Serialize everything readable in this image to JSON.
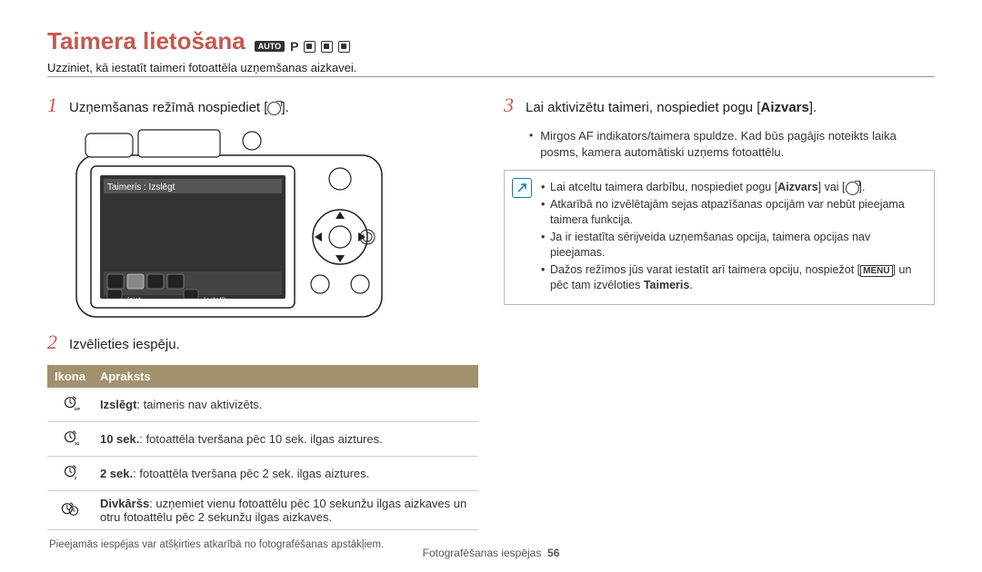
{
  "title": "Taimera lietošana",
  "subtitle": "Uzziniet, kā iestatīt taimeri fotoattēla uzņemšanas aizkavei.",
  "modes": {
    "auto": "AUTO",
    "p": "P"
  },
  "steps": {
    "s1": "Uzņemšanas režīmā nospiediet [",
    "s1_end": "].",
    "s2": "Izvēlieties iespēju.",
    "s3_a": "Lai aktivizētu taimeri, nospiediet pogu [",
    "s3_bold": "Aizvars",
    "s3_b": "]."
  },
  "camera_lcd": {
    "title": "Taimeris : Izslēgt",
    "exit": "Iziet",
    "set": "Iestatīt"
  },
  "table": {
    "h1": "Ikona",
    "h2": "Apraksts",
    "rows": [
      {
        "icon_sub": "OFF",
        "label_bold": "Izslēgt",
        "label_rest": ": taimeris nav aktivizēts."
      },
      {
        "icon_sub": "10",
        "label_bold": "10 sek.",
        "label_rest": ": fotoattēla tveršana pēc 10 sek. ilgas aiztures."
      },
      {
        "icon_sub": "2",
        "label_bold": "2 sek.",
        "label_rest": ": fotoattēla tveršana pēc 2 sek. ilgas aiztures."
      },
      {
        "icon_sub": "",
        "label_bold": "Divkāršs",
        "label_rest": ": uzņemiet vienu fotoattēlu pēc 10 sekunžu ilgas aizkaves un otru fotoattēlu pēc 2 sekunžu ilgas aizkaves."
      }
    ]
  },
  "note": "Pieejamās iespējas var atšķirties atkarībā no fotografēšanas apstākļiem.",
  "right_bullets": [
    "Mirgos AF indikators/taimera spuldze. Kad būs pagājis noteikts laika posms, kamera automātiski uzņems fotoattēlu."
  ],
  "infobox": [
    {
      "pre": "Lai atceltu taimera darbību, nospiediet pogu [",
      "bold": "Aizvars",
      "post": "] vai [",
      "icon": true,
      "end": "]."
    },
    {
      "text": "Atkarībā no izvēlētajām sejas atpazīšanas opcijām var nebūt pieejama taimera funkcija."
    },
    {
      "text": "Ja ir iestatīta sērijveida uzņemšanas opcija, taimera opcijas nav pieejamas."
    },
    {
      "pre": "Dažos režīmos jūs varat iestatīt arī taimera opciju, nospiežot [",
      "menu": "MENU",
      "post": "] un pēc tam izvēloties ",
      "bold2": "Taimeris",
      "end": "."
    }
  ],
  "footer": {
    "label": "Fotografēšanas iespējas",
    "page": "56"
  }
}
